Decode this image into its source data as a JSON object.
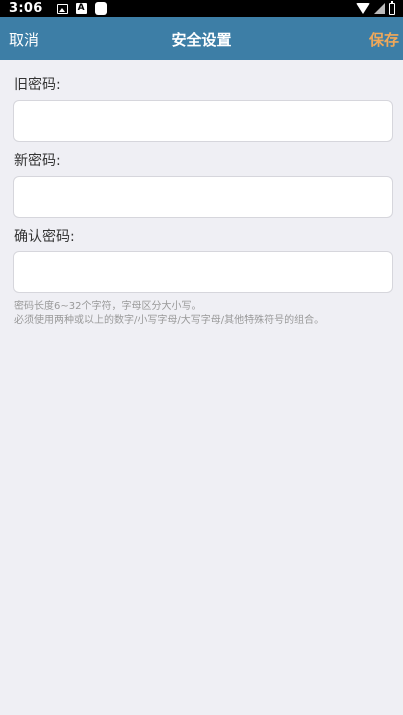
{
  "status_bar": {
    "time": "3:06",
    "icons": [
      "image-icon",
      "a-icon",
      "blank-icon",
      "wifi-icon",
      "signal-icon",
      "battery-icon"
    ]
  },
  "nav": {
    "cancel_label": "取消",
    "title": "安全设置",
    "save_label": "保存",
    "bar_color": "#3d7ea6",
    "save_color": "#f0a85a"
  },
  "form": {
    "old_password": {
      "label": "旧密码:",
      "value": "",
      "placeholder": ""
    },
    "new_password": {
      "label": "新密码:",
      "value": "",
      "placeholder": ""
    },
    "confirm_password": {
      "label": "确认密码:",
      "value": "",
      "placeholder": ""
    }
  },
  "hints": {
    "line1": "密码长度6~32个字符，字母区分大小写。",
    "line2": "必须使用两种或以上的数字/小写字母/大写字母/其他特殊符号的组合。"
  }
}
